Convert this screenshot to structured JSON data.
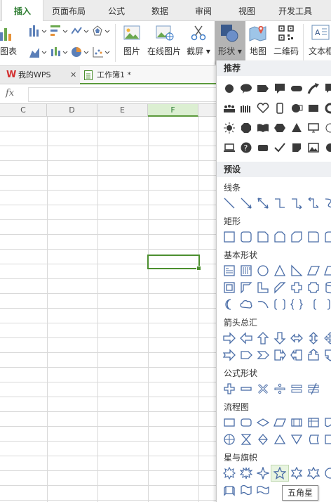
{
  "ribbon_tabs": [
    "插入",
    "页面布局",
    "公式",
    "数据",
    "审阅",
    "视图",
    "开发工具"
  ],
  "ribbon": {
    "chart_label": "图表",
    "picture_label": "图片",
    "online_picture_label": "在线图片",
    "screenshot_label": "截屏",
    "shape_label": "形状",
    "map_label": "地图",
    "qrcode_label": "二维码",
    "textbox_label": "文本框"
  },
  "doc_tabs": {
    "mywps": "我的WPS",
    "workbook": "工作簿1 *"
  },
  "formula_bar": {
    "fx": "fx",
    "value": ""
  },
  "columns": [
    "C",
    "D",
    "E",
    "F"
  ],
  "shape_panel": {
    "recommended": "推荐",
    "preset": "预设",
    "sections": [
      "线条",
      "矩形",
      "基本形状",
      "箭头总汇",
      "公式形状",
      "流程图",
      "星与旗帜"
    ]
  },
  "tooltip": "五角星",
  "colors": {
    "accent": "#4c8f2f",
    "shape_stroke": "#4a6da7"
  }
}
